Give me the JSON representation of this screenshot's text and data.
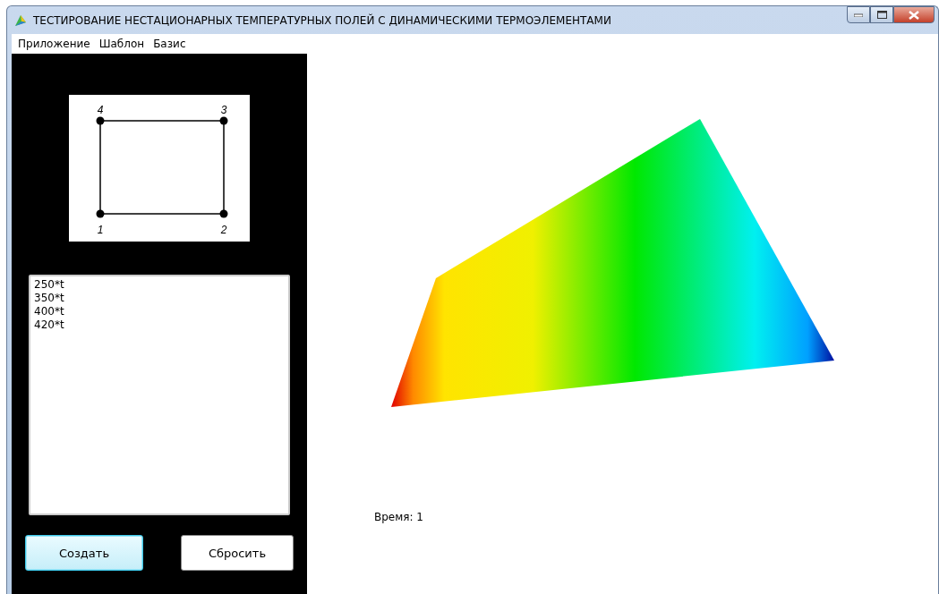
{
  "window": {
    "title": "ТЕСТИРОВАНИЕ НЕСТАЦИОНАРНЫХ ТЕМПЕРАТУРНЫХ ПОЛЕЙ С ДИНАМИЧЕСКИМИ ТЕРМОЭЛЕМЕНТАМИ"
  },
  "menu": [
    "Приложение",
    "Шаблон",
    "Базис"
  ],
  "template": {
    "nodes": [
      "4",
      "3",
      "1",
      "2"
    ]
  },
  "functions": [
    "250*t",
    "350*t",
    "400*t",
    "420*t"
  ],
  "buttons": [
    {
      "label": "Создать",
      "focused": true
    },
    {
      "label": "Сбросить",
      "focused": false
    }
  ],
  "time_label": "Время: 1"
}
